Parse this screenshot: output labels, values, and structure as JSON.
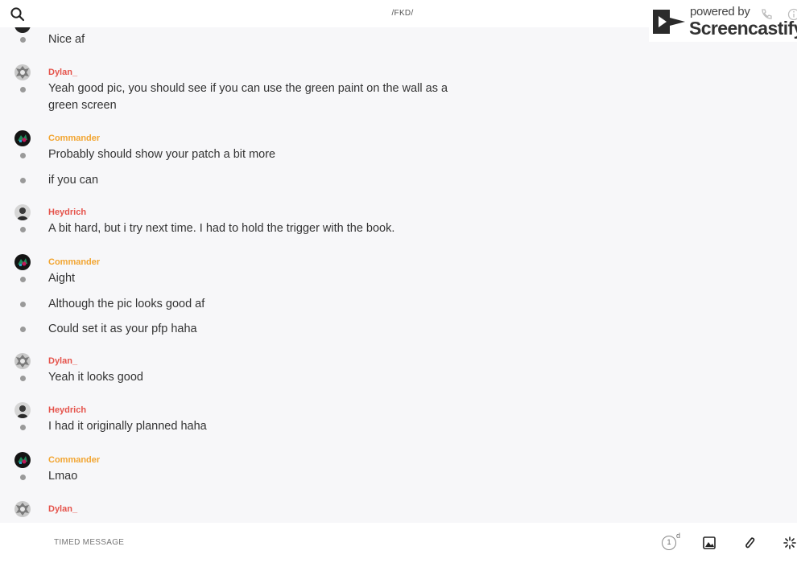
{
  "header": {
    "title": "/FKD/"
  },
  "watermark": {
    "powered": "powered by",
    "brand": "Screencastify"
  },
  "colors": {
    "dylan": "#e5534b",
    "commander": "#f2a531",
    "heydrich": "#e5534b"
  },
  "messages": [
    {
      "text": "Nice af"
    },
    {
      "user": "Dylan_",
      "text": "Yeah good pic, you should see if you can use the green paint on the wall as a green screen"
    },
    {
      "user": "Commander",
      "text": "Probably should show your patch a bit more"
    },
    {
      "text": "if you can"
    },
    {
      "user": "Heydrich",
      "text": "A bit hard, but i try next time. I had to hold the trigger with the book."
    },
    {
      "user": "Commander",
      "text": "Aight"
    },
    {
      "text": "Although the pic looks good af"
    },
    {
      "text": "Could set it as your pfp haha"
    },
    {
      "user": "Dylan_",
      "text": "Yeah it looks good"
    },
    {
      "user": "Heydrich",
      "text": "I had it originally planned haha"
    },
    {
      "user": "Commander",
      "text": "Lmao"
    },
    {
      "user": "Dylan_"
    }
  ],
  "composer": {
    "placeholder": "TIMED MESSAGE",
    "timer_value": "1",
    "timer_unit": "d"
  },
  "icons": {
    "search": "search-icon",
    "image": "image-icon",
    "attach": "paperclip-icon",
    "loading": "spinner-icon"
  }
}
